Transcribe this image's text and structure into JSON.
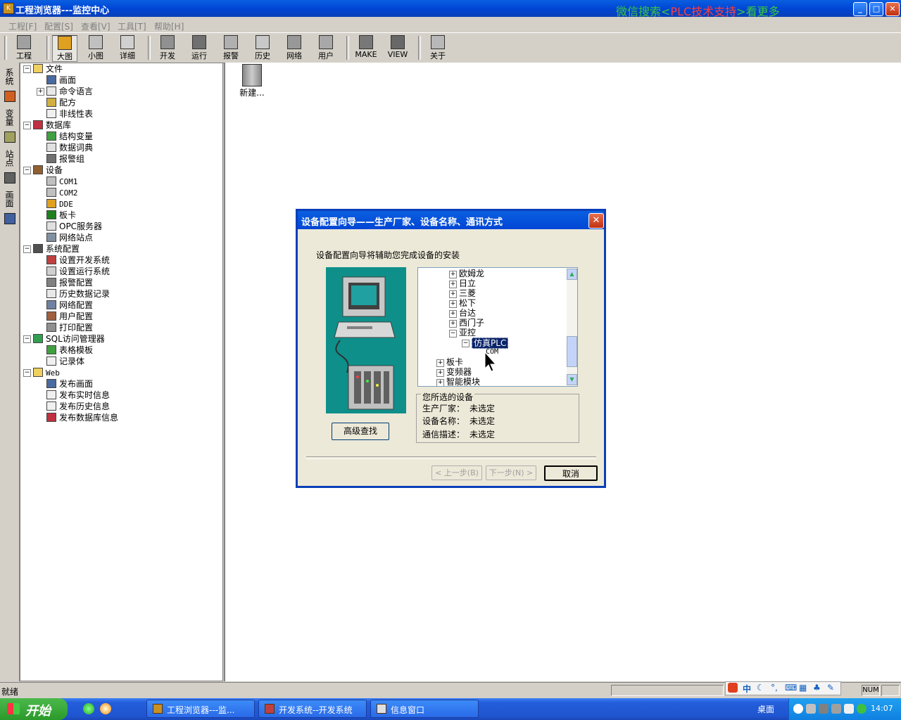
{
  "window": {
    "title": "工程浏览器---监控中心",
    "promo_a": "微信搜索",
    "promo_b": "PLC技术支持",
    "promo_c": "看更多"
  },
  "menu": [
    "工程[F]",
    "配置[S]",
    "查看[V]",
    "工具[T]",
    "帮助[H]"
  ],
  "toolbar": [
    "工程",
    "大图",
    "小图",
    "详细",
    "开发",
    "运行",
    "报警",
    "历史",
    "网络",
    "用户",
    "MAKE",
    "VIEW",
    "关于"
  ],
  "vtabs": [
    "系统",
    "变量",
    "站点",
    "画面"
  ],
  "tree": {
    "n0": "文件",
    "n1": "画面",
    "n2": "命令语言",
    "n3": "配方",
    "n4": "非线性表",
    "n5": "数据库",
    "n6": "结构变量",
    "n7": "数据词典",
    "n8": "报警组",
    "n9": "设备",
    "n10": "COM1",
    "n11": "COM2",
    "n12": "DDE",
    "n13": "板卡",
    "n14": "OPC服务器",
    "n15": "网络站点",
    "n16": "系统配置",
    "n17": "设置开发系统",
    "n18": "设置运行系统",
    "n19": "报警配置",
    "n20": "历史数据记录",
    "n21": "网络配置",
    "n22": "用户配置",
    "n23": "打印配置",
    "n24": "SQL访问管理器",
    "n25": "表格模板",
    "n26": "记录体",
    "n27": "Web",
    "n28": "发布画面",
    "n29": "发布实时信息",
    "n30": "发布历史信息",
    "n31": "发布数据库信息"
  },
  "content": {
    "new_item": "新建..."
  },
  "dialog": {
    "title": "设备配置向导——生产厂家、设备名称、通讯方式",
    "intro": "设备配置向导将辅助您完成设备的安装",
    "adv_search": "高级查找",
    "devices": {
      "d0": "欧姆龙",
      "d1": "日立",
      "d2": "三菱",
      "d3": "松下",
      "d4": "台达",
      "d5": "西门子",
      "d6": "亚控",
      "d7": "仿真PLC",
      "d8": "COM",
      "d9": "板卡",
      "d10": "变频器",
      "d11": "智能模块"
    },
    "selected_legend": "您所选的设备",
    "manufacturer_label": "生产厂家：",
    "manufacturer_value": "未选定",
    "device_label": "设备名称：",
    "device_value": "未选定",
    "comm_label": "通信描述：",
    "comm_value": "未选定",
    "prev": "< 上一步(B)",
    "next": "下一步(N) >",
    "cancel": "取消"
  },
  "status": {
    "text": "就绪",
    "num": "NUM",
    "ime_main": "中"
  },
  "taskbar": {
    "start": "开始",
    "tasks": [
      "工程浏览器---监...",
      "开发系统--开发系统",
      "信息窗口"
    ],
    "desktop": "桌面",
    "clock": "14:07"
  },
  "colors": {
    "titlebar": "#0046d5",
    "taskbar": "#245edb",
    "start": "#2a9a2a",
    "tree_selected": "#0a246a"
  }
}
